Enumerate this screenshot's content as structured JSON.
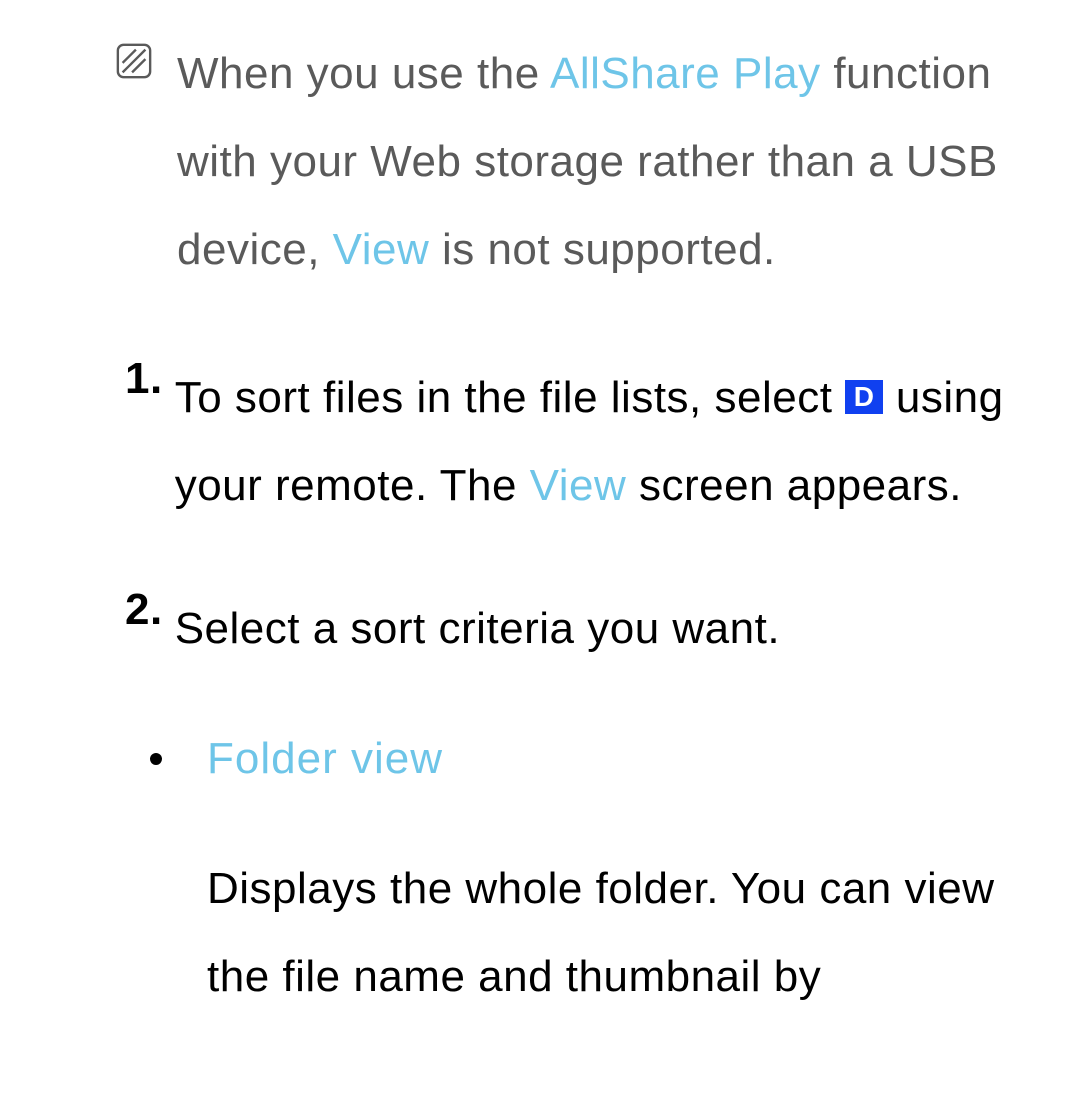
{
  "note": {
    "text_before_highlight1": "When you use the ",
    "highlight1": "AllShare Play",
    "text_middle": " function with your Web storage rather than a USB device, ",
    "highlight2": "View",
    "text_after": " is not supported."
  },
  "steps": [
    {
      "number": "1.",
      "text_before_button": "To sort files in the file lists, select ",
      "button_label": "D",
      "text_after_button": " using your remote. The ",
      "highlight": "View",
      "text_after_highlight": " screen appears."
    },
    {
      "number": "2.",
      "text": "Select a sort criteria you want."
    }
  ],
  "bullet": {
    "title": "Folder view",
    "description": "Displays the whole folder. You can view the file name and thumbnail by"
  }
}
